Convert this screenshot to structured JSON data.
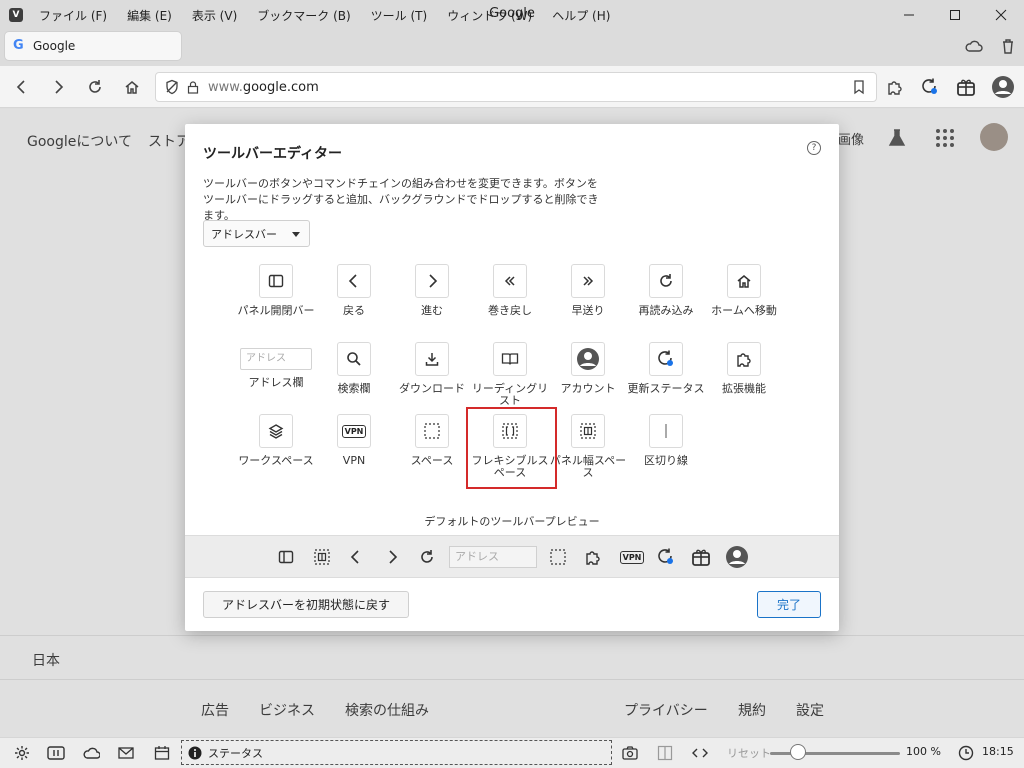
{
  "window": {
    "title": "Google",
    "menu": [
      "ファイル (F)",
      "編集 (E)",
      "表示 (V)",
      "ブックマーク (B)",
      "ツール (T)",
      "ウィンドウ (W)",
      "ヘルプ (H)"
    ]
  },
  "tab": {
    "title": "Google",
    "favicon": "G"
  },
  "address": {
    "url_host": "www.",
    "url_domain": "google.com"
  },
  "page": {
    "about": "Googleについて",
    "store": "ストア",
    "images": "画像",
    "country": "日本",
    "footer_left": [
      "広告",
      "ビジネス",
      "検索の仕組み"
    ],
    "footer_right": [
      "プライバシー",
      "規約",
      "設定"
    ]
  },
  "dialog": {
    "title": "ツールバーエディター",
    "help": "?",
    "description": "ツールバーのボタンやコマンドチェインの組み合わせを変更できます。ボタンをツールバーにドラッグすると追加、バックグラウンドでドロップすると削除できます。",
    "select_value": "アドレスバー",
    "items_row1": [
      "パネル開閉バー",
      "戻る",
      "進む",
      "巻き戻し",
      "早送り",
      "再読み込み",
      "ホームへ移動"
    ],
    "items_row2": [
      "アドレス欄",
      "検索欄",
      "ダウンロード",
      "リーディングリスト",
      "アカウント",
      "更新ステータス",
      "拡張機能"
    ],
    "items_row3": [
      "ワークスペース",
      "VPN",
      "スペース",
      "フレキシブルスペース",
      "パネル幅スペース",
      "区切り線"
    ],
    "address_placeholder": "アドレス",
    "vpn_badge": "VPN",
    "preview_label": "デフォルトのツールバープレビュー",
    "preview_address": "アドレス",
    "preview_vpn": "VPN",
    "reset_button": "アドレスバーを初期状態に戻す",
    "done_button": "完了"
  },
  "statusbar": {
    "status": "ステータス",
    "reset": "リセット",
    "zoom": "100 %",
    "time": "18:15",
    "zoom_level_percent": 100
  },
  "colors": {
    "accent": "#1a73c8",
    "highlight": "#d42a2a",
    "status_dot": "#1a73e8"
  }
}
